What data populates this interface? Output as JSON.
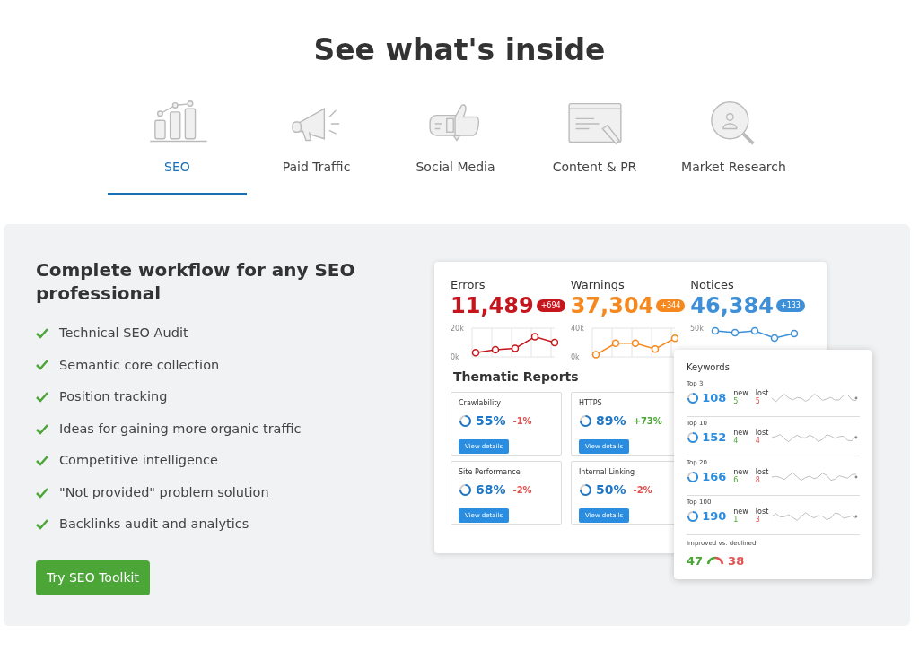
{
  "heading": "See what's inside",
  "tabs": [
    {
      "label": "SEO",
      "selected": true
    },
    {
      "label": "Paid Traffic",
      "selected": false
    },
    {
      "label": "Social Media",
      "selected": false
    },
    {
      "label": "Content & PR",
      "selected": false
    },
    {
      "label": "Market Research",
      "selected": false
    }
  ],
  "panel": {
    "title": "Complete workflow for any SEO professional",
    "features": [
      "Technical SEO Audit",
      "Semantic core collection",
      "Position tracking",
      "Ideas for gaining more organic traffic",
      "Competitive intelligence",
      "\"Not provided\" problem solution",
      "Backlinks audit and analytics"
    ],
    "button": "Try SEO Toolkit"
  },
  "metrics": [
    {
      "label": "Errors",
      "value": "11,489",
      "delta": "+694",
      "color": "#c4161c",
      "chart_data": {
        "type": "line",
        "yticks": [
          {
            "value": 0,
            "label": "0k"
          },
          {
            "value": 20000,
            "label": "20k"
          }
        ],
        "ylim": [
          0,
          20000
        ],
        "series": [
          {
            "color": "#c4161c",
            "marker": true,
            "values": [
              3000,
              5000,
              6000,
              14000,
              10000
            ]
          }
        ]
      }
    },
    {
      "label": "Warnings",
      "value": "37,304",
      "delta": "+344",
      "color": "#f5891f",
      "chart_data": {
        "type": "line",
        "yticks": [
          {
            "value": 0,
            "label": "0k"
          },
          {
            "value": 40000,
            "label": "40k"
          }
        ],
        "ylim": [
          0,
          40000
        ],
        "series": [
          {
            "color": "#f5891f",
            "marker": true,
            "values": [
              3000,
              19000,
              19000,
              11000,
              26000
            ]
          }
        ]
      }
    },
    {
      "label": "Notices",
      "value": "46,384",
      "delta": "+133",
      "color": "#3d8fd8",
      "scale_label": "50k"
    }
  ],
  "thematic": {
    "title": "Thematic Reports",
    "reports": [
      {
        "name": "Crawlability",
        "value": "55%",
        "change": "-1%",
        "color": "#e05050",
        "button": "View details"
      },
      {
        "name": "HTTPS",
        "value": "89%",
        "change": "+73%",
        "color": "#4ba537",
        "button": "View details"
      },
      {
        "name": "Site Performance",
        "value": "68%",
        "change": "-2%",
        "color": "#e05050",
        "button": "View details"
      },
      {
        "name": "Internal Linking",
        "value": "50%",
        "change": "-2%",
        "color": "#e05050",
        "button": "View details"
      }
    ]
  },
  "keywords": {
    "title": "Keywords",
    "rows": [
      {
        "label": "Top 3",
        "value": "108",
        "new_label": "new",
        "new": "5",
        "lost_label": "lost",
        "lost": "5"
      },
      {
        "label": "Top 10",
        "value": "152",
        "new_label": "new",
        "new": "4",
        "lost_label": "lost",
        "lost": "4"
      },
      {
        "label": "Top 20",
        "value": "166",
        "new_label": "new",
        "new": "6",
        "lost_label": "lost",
        "lost": "8"
      },
      {
        "label": "Top 100",
        "value": "190",
        "new_label": "new",
        "new": "1",
        "lost_label": "lost",
        "lost": "3"
      }
    ],
    "summary": {
      "label": "Improved vs. declined",
      "improved": "47",
      "declined": "38"
    }
  }
}
